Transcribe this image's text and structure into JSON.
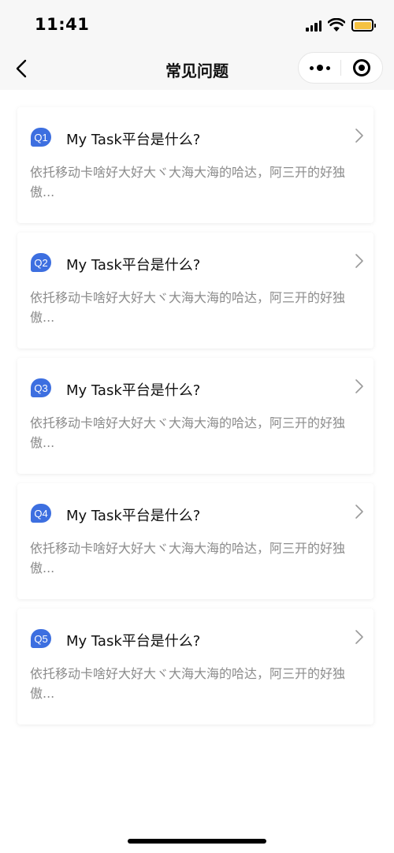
{
  "status_bar": {
    "time": "11:41",
    "battery_level": 1.0,
    "battery_color": "#f5c242",
    "icons": [
      "signal-icon",
      "wifi-icon",
      "battery-icon"
    ]
  },
  "nav": {
    "title": "常见问题",
    "back_icon": "chevron-left-icon",
    "more_icon": "more-dots-icon",
    "close_icon": "target-circle-icon"
  },
  "accent_color": "#3d6fe0",
  "faq": [
    {
      "badge": "Q1",
      "question": "My Task平台是什么?",
      "answer": "依托移动卡啥好大好大ヾ大海大海的哈达，阿三开的好独傲..."
    },
    {
      "badge": "Q2",
      "question": "My Task平台是什么?",
      "answer": "依托移动卡啥好大好大ヾ大海大海的哈达，阿三开的好独傲..."
    },
    {
      "badge": "Q3",
      "question": "My Task平台是什么?",
      "answer": "依托移动卡啥好大好大ヾ大海大海的哈达，阿三开的好独傲..."
    },
    {
      "badge": "Q4",
      "question": "My Task平台是什么?",
      "answer": "依托移动卡啥好大好大ヾ大海大海的哈达，阿三开的好独傲..."
    },
    {
      "badge": "Q5",
      "question": "My Task平台是什么?",
      "answer": "依托移动卡啥好大好大ヾ大海大海的哈达，阿三开的好独傲..."
    }
  ]
}
